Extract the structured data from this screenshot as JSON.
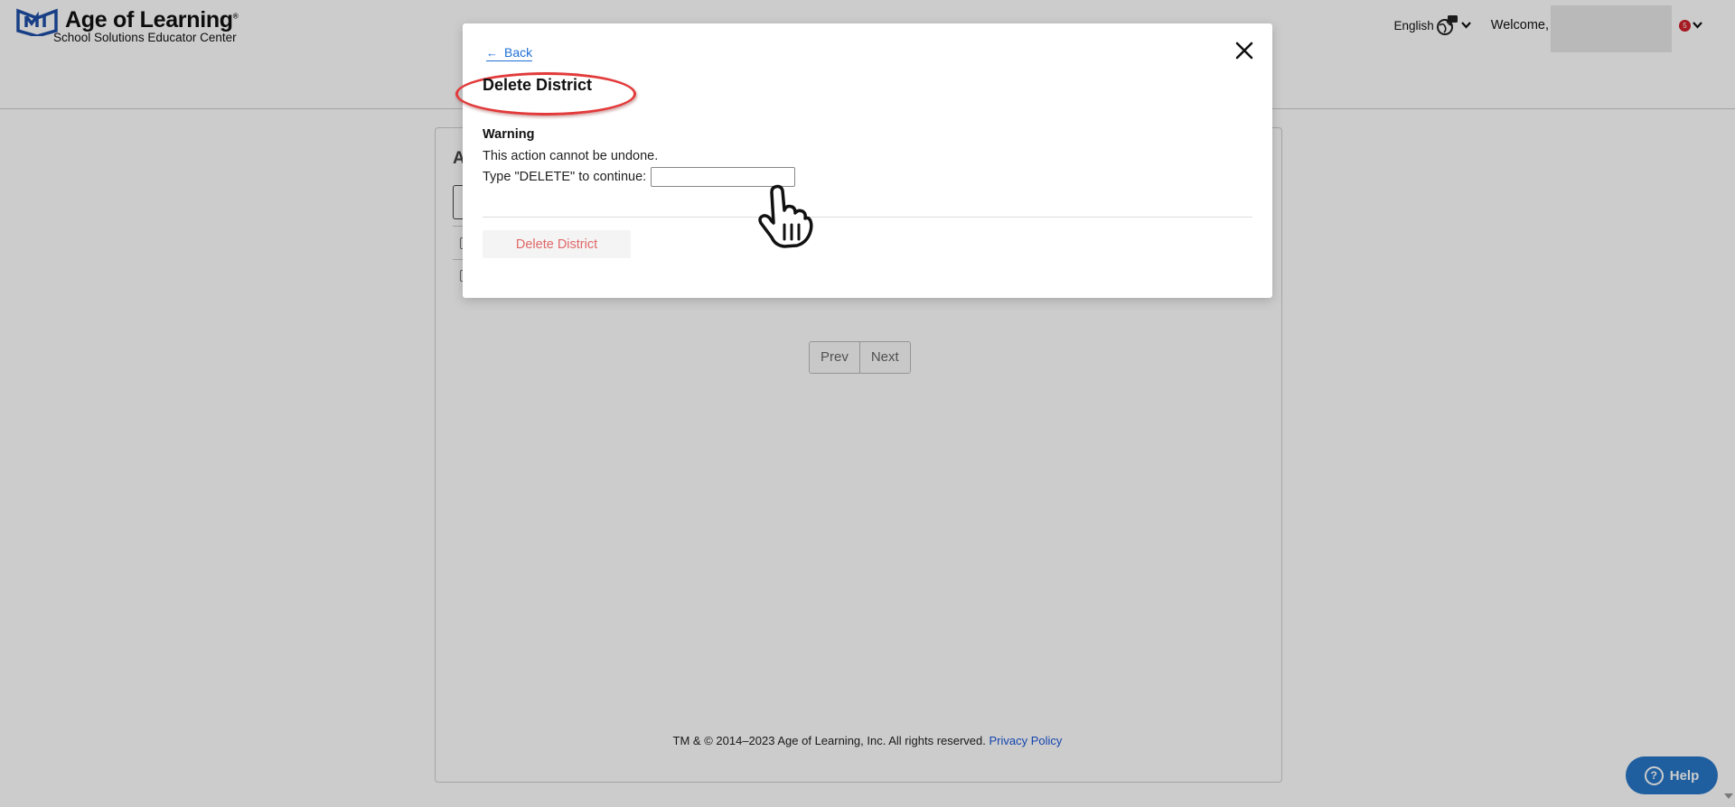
{
  "header": {
    "brand_title": "Age of Learning",
    "brand_trademark": "®",
    "brand_subtitle": "School Solutions Educator Center",
    "language_label": "English",
    "welcome_label": "Welcome,",
    "notification_count": "5"
  },
  "page": {
    "panel_heading_initial": "A",
    "pager": {
      "prev_label": "Prev",
      "next_label": "Next"
    },
    "footer": {
      "copyright": "TM & © 2014–2023 Age of Learning, Inc. All rights reserved.",
      "privacy_label": "Privacy Policy"
    },
    "help_label": "Help"
  },
  "modal": {
    "back_label": "Back",
    "title": "Delete District",
    "warning_title": "Warning",
    "warning_text": "This action cannot be undone.",
    "confirm_prompt": "Type \"DELETE\" to continue:",
    "confirm_value": "",
    "delete_button_label": "Delete District"
  },
  "colors": {
    "link": "#1f6fd6",
    "brand": "#1f4fa8",
    "annotation_ring": "#e23a3a",
    "disabled_danger_text": "#e06868",
    "help_button": "#2777c9",
    "badge": "#d0202a"
  },
  "icons": [
    "logo-mark-icon",
    "back-arrow-icon",
    "close-icon",
    "language-globe-icon",
    "chevron-down-icon",
    "help-icon",
    "hand-pointer-icon"
  ]
}
